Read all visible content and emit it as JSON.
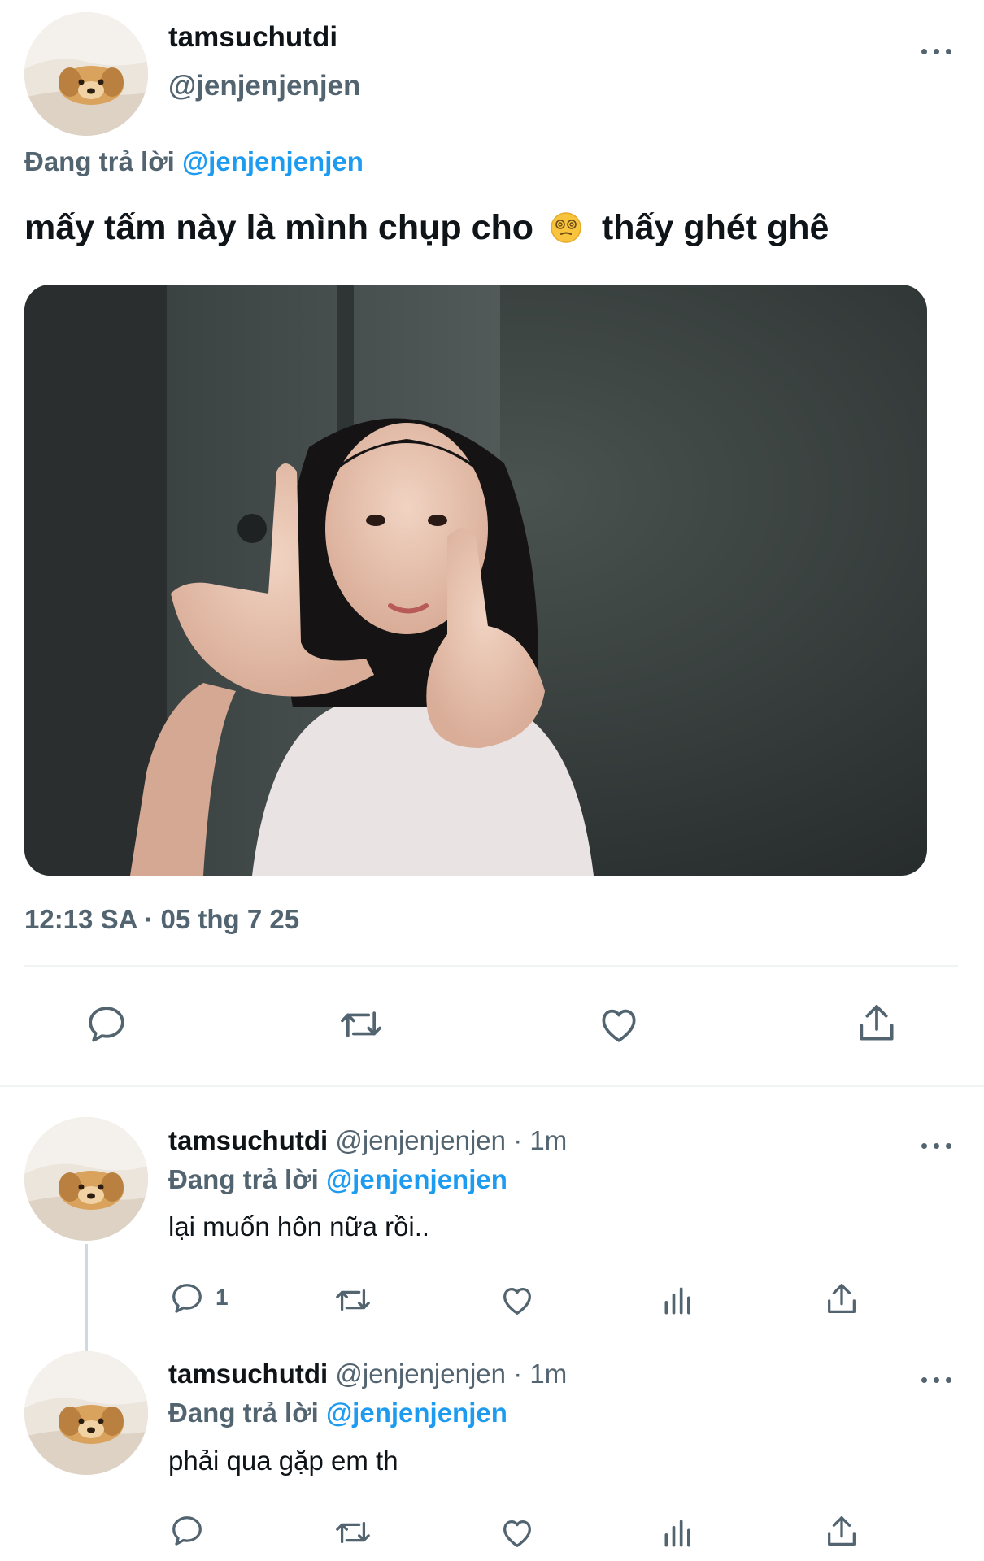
{
  "main_tweet": {
    "display_name": "tamsuchutdi",
    "handle": "@jenjenjenjen",
    "reply_prefix": "Đang trả lời",
    "reply_to": "@jenjenjenjen",
    "text_before_emoji": "mấy tấm này là mình chụp cho",
    "emoji": "dizzy-face-emoji",
    "text_after_emoji": "thấy ghét ghê",
    "timestamp": "12:13 SA · 05 thg 7 25"
  },
  "replies": [
    {
      "display_name": "tamsuchutdi",
      "handle": "@jenjenjenjen",
      "time": "· 1m",
      "reply_prefix": "Đang trả lời",
      "reply_to": "@jenjenjenjen",
      "text": "lại muốn hôn nữa rồi..",
      "reply_count": "1"
    },
    {
      "display_name": "tamsuchutdi",
      "handle": "@jenjenjenjen",
      "time": "· 1m",
      "reply_prefix": "Đang trả lời",
      "reply_to": "@jenjenjenjen",
      "text": "phải qua gặp em th",
      "reply_count": ""
    }
  ],
  "colors": {
    "accent": "#1d9bf0",
    "text": "#0f1419",
    "muted": "#536471",
    "divider": "#eff3f4"
  }
}
